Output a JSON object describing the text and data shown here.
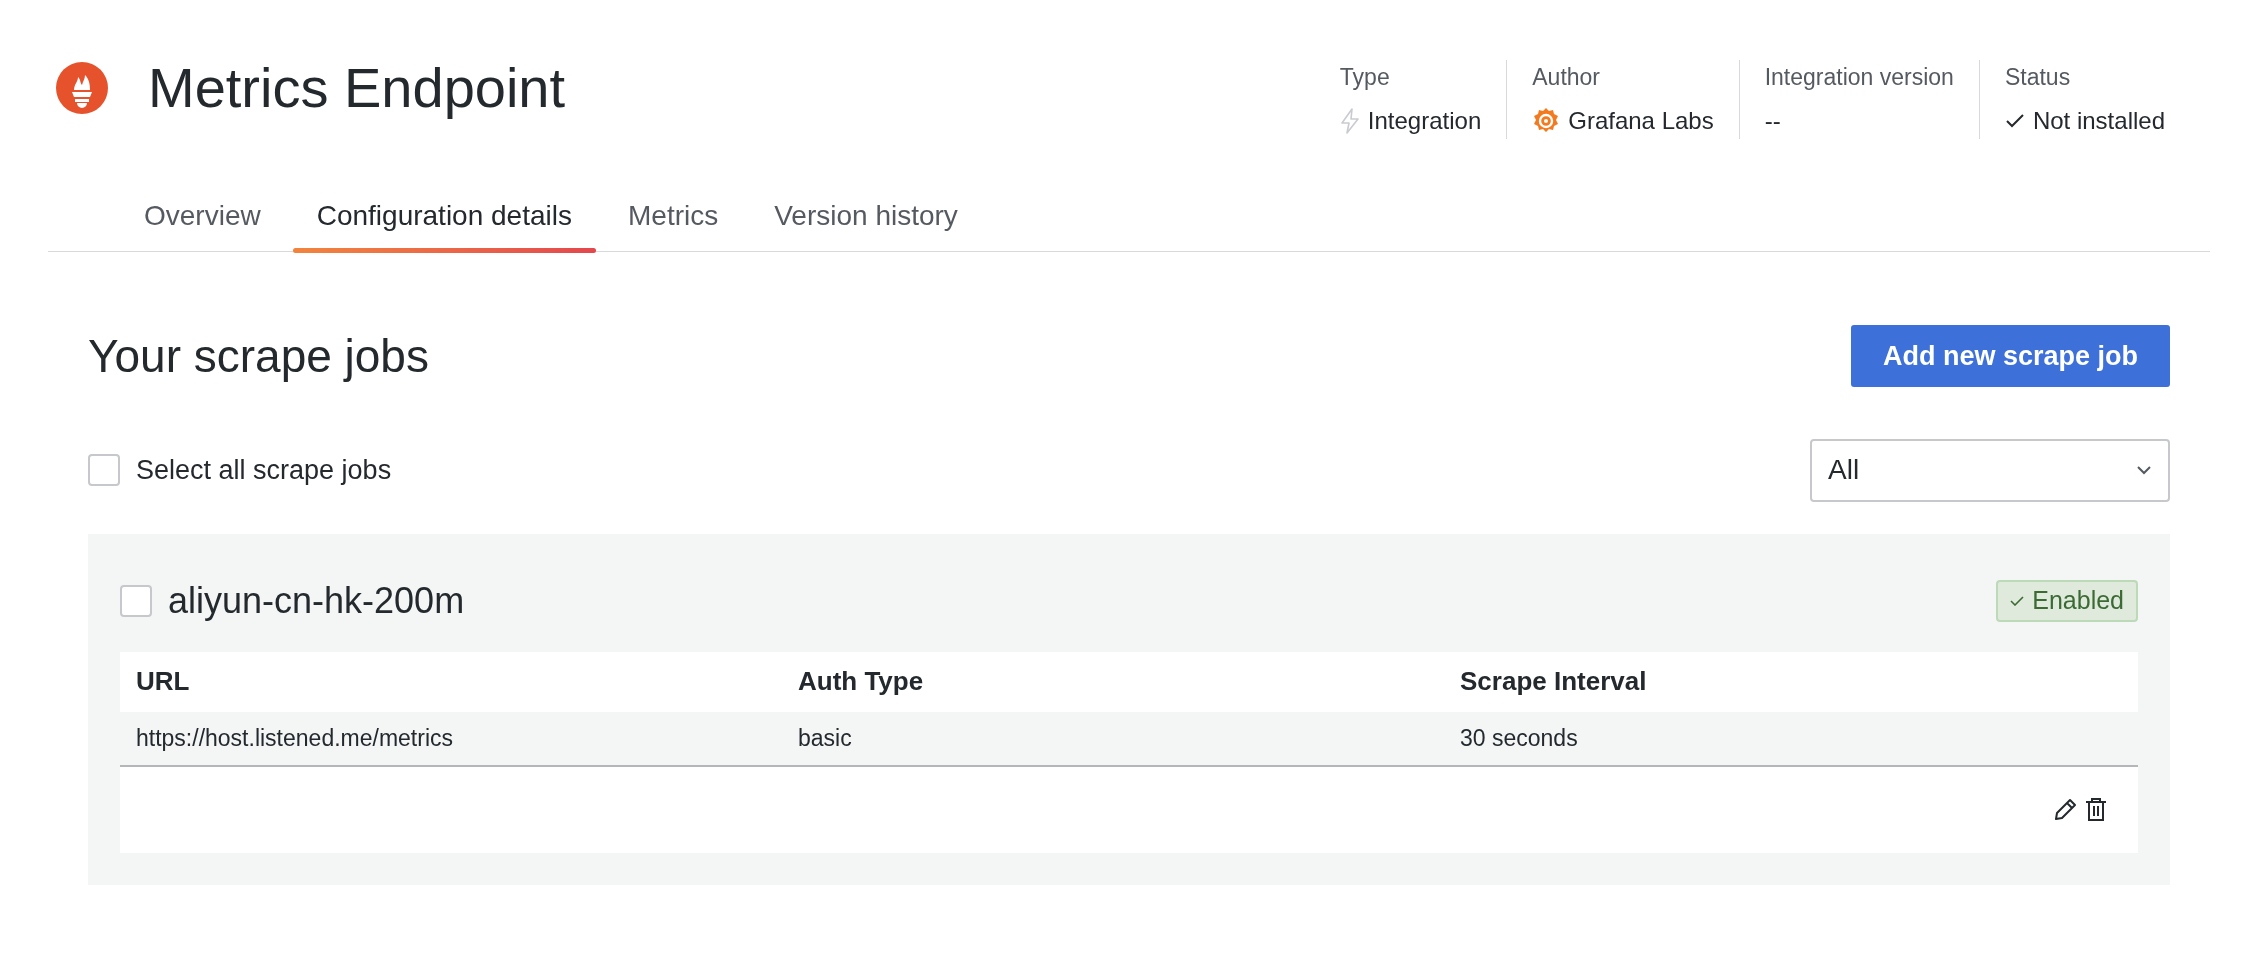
{
  "header": {
    "title": "Metrics Endpoint"
  },
  "meta": [
    {
      "kind": "type",
      "label": "Type",
      "value": "Integration"
    },
    {
      "kind": "author",
      "label": "Author",
      "value": "Grafana Labs"
    },
    {
      "kind": "version",
      "label": "Integration version",
      "value": "--"
    },
    {
      "kind": "status",
      "label": "Status",
      "value": "Not installed"
    }
  ],
  "tabs": [
    {
      "label": "Overview",
      "selected": false
    },
    {
      "label": "Configuration details",
      "selected": true
    },
    {
      "label": "Metrics",
      "selected": false
    },
    {
      "label": "Version history",
      "selected": false
    }
  ],
  "section": {
    "title": "Your scrape jobs",
    "add_button": "Add new scrape job",
    "select_all": {
      "label": "Select all scrape jobs",
      "checked": false
    },
    "filter": {
      "value": "All"
    }
  },
  "jobs": [
    {
      "title": "aliyun-cn-hk-200m",
      "checked": false,
      "enabled": true,
      "badge": "Enabled",
      "columns": [
        "URL",
        "Auth Type",
        "Scrape Interval"
      ],
      "values": [
        "https://host.listened.me/metrics",
        "basic",
        "30 seconds"
      ]
    }
  ]
}
